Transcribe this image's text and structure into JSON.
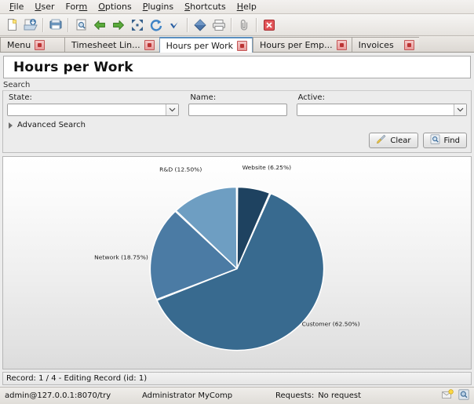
{
  "menubar": {
    "items": [
      {
        "name": "file",
        "prefix": "",
        "accel": "F",
        "rest": "ile"
      },
      {
        "name": "user",
        "prefix": "",
        "accel": "U",
        "rest": "ser"
      },
      {
        "name": "form",
        "prefix": "For",
        "accel": "m",
        "rest": ""
      },
      {
        "name": "options",
        "prefix": "",
        "accel": "O",
        "rest": "ptions"
      },
      {
        "name": "plugins",
        "prefix": "",
        "accel": "P",
        "rest": "lugins"
      },
      {
        "name": "shortcuts",
        "prefix": "",
        "accel": "S",
        "rest": "hortcuts"
      },
      {
        "name": "help",
        "prefix": "",
        "accel": "H",
        "rest": "elp"
      }
    ]
  },
  "toolbar": {
    "buttons": [
      {
        "icon": "new-document-icon",
        "label": "New"
      },
      {
        "icon": "open-document-icon",
        "label": "Open"
      },
      {
        "sep": true
      },
      {
        "icon": "save-icon",
        "label": "Save"
      },
      {
        "sep": true
      },
      {
        "icon": "search-record-icon",
        "label": "Search"
      },
      {
        "icon": "previous-icon",
        "label": "Previous"
      },
      {
        "icon": "next-icon",
        "label": "Next"
      },
      {
        "icon": "fullscreen-icon",
        "label": "Full Screen"
      },
      {
        "icon": "reload-icon",
        "label": "Reload"
      },
      {
        "icon": "check-icon",
        "label": "Validate"
      },
      {
        "sep": true
      },
      {
        "icon": "diamond-icon",
        "label": "Action"
      },
      {
        "icon": "print-icon",
        "label": "Print"
      },
      {
        "sep": true
      },
      {
        "icon": "attachment-icon",
        "label": "Attachment"
      },
      {
        "sep": true
      },
      {
        "icon": "close-red-icon",
        "label": "Close"
      }
    ]
  },
  "tabs": [
    {
      "label": "Menu",
      "active": false,
      "closable": true
    },
    {
      "label": "Timesheet Lin...",
      "active": false,
      "closable": true
    },
    {
      "label": "Hours per Work",
      "active": true,
      "closable": true
    },
    {
      "label": "Hours per Emp...",
      "active": false,
      "closable": true
    },
    {
      "label": "Invoices",
      "active": false,
      "closable": true
    }
  ],
  "form": {
    "title": "Hours per Work",
    "search_group_label": "Search",
    "fields": {
      "state": {
        "label": "State:",
        "value": "",
        "placeholder": ""
      },
      "name": {
        "label": "Name:",
        "value": "",
        "placeholder": ""
      },
      "active": {
        "label": "Active:",
        "value": "",
        "placeholder": ""
      }
    },
    "advanced_search_label": "Advanced Search",
    "buttons": {
      "clear": "Clear",
      "find": "Find"
    },
    "record_status": "Record: 1 / 4 - Editing Record (id: 1)"
  },
  "chart_data": {
    "type": "pie",
    "title": "",
    "categories": [
      "Website",
      "Customer",
      "Network",
      "R&D"
    ],
    "values": [
      6.25,
      62.5,
      18.75,
      12.5
    ],
    "labels": [
      "Website (6.25%)",
      "Customer (62.50%)",
      "Network (18.75%)",
      "R&D (12.50%)"
    ],
    "colors": [
      "#1e4260",
      "#386a8f",
      "#4b7ba4",
      "#6e9ec2"
    ],
    "slice_border_color": "#ffffff",
    "start_angle_deg": -90,
    "direction": "clockwise",
    "legend": "none",
    "grid": false,
    "background_gradient": [
      "#ffffff",
      "#dcdcdc"
    ]
  },
  "statusbar": {
    "connection": "admin@127.0.0.1:8070/try",
    "user": "Administrator MyComp",
    "requests_label": "Requests:",
    "requests_value": "No request",
    "icons": [
      "notification-icon",
      "search-status-icon"
    ]
  }
}
